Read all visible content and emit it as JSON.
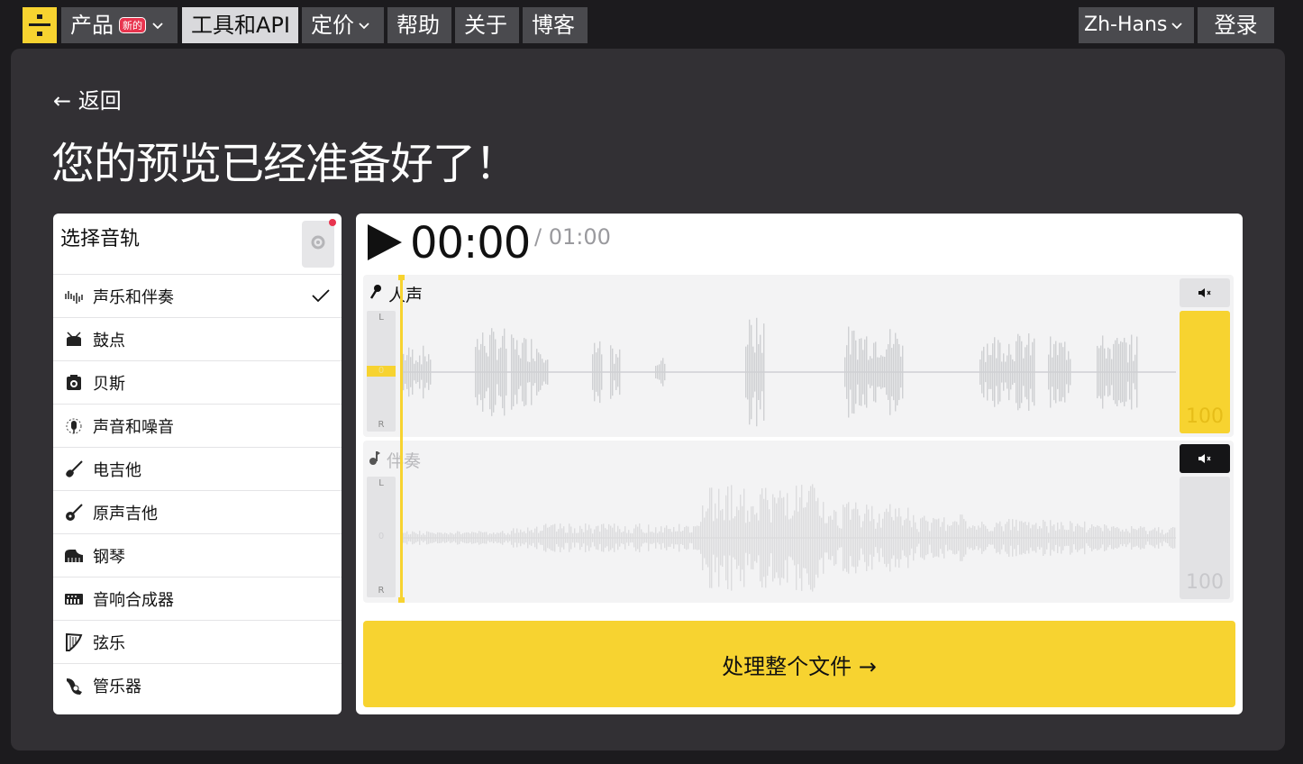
{
  "nav": {
    "products_label": "产品",
    "new_badge": "新的",
    "tools_label": "工具和API",
    "pricing_label": "定价",
    "help_label": "帮助",
    "about_label": "关于",
    "blog_label": "博客",
    "language_label": "Zh-Hans",
    "login_label": "登录"
  },
  "page": {
    "back_label": "← 返回",
    "title": "您的预览已经准备好了！"
  },
  "tracks": {
    "title": "选择音轨",
    "items": [
      {
        "label": "声乐和伴奏",
        "icon": "waveform-icon",
        "selected": true
      },
      {
        "label": "鼓点",
        "icon": "drum-icon"
      },
      {
        "label": "贝斯",
        "icon": "bass-amp-icon"
      },
      {
        "label": "声音和噪音",
        "icon": "microphone-icon"
      },
      {
        "label": "电吉他",
        "icon": "electric-guitar-icon"
      },
      {
        "label": "原声吉他",
        "icon": "acoustic-guitar-icon"
      },
      {
        "label": "钢琴",
        "icon": "piano-icon"
      },
      {
        "label": "音响合成器",
        "icon": "synthesizer-icon"
      },
      {
        "label": "弦乐",
        "icon": "harp-icon"
      },
      {
        "label": "管乐器",
        "icon": "horn-icon"
      }
    ]
  },
  "player": {
    "current_time": "00:00",
    "total_time": "/ 01:00",
    "lanes": [
      {
        "label": "人声",
        "pan_l": "L",
        "pan_mid": "0",
        "pan_r": "R",
        "volume": "100",
        "muted": false
      },
      {
        "label": "伴奏",
        "pan_l": "L",
        "pan_mid": "0",
        "pan_r": "R",
        "volume": "100",
        "muted": true
      }
    ],
    "process_label": "处理整个文件 →"
  },
  "colors": {
    "accent": "#f7d330",
    "panel": "#323034",
    "background": "#1c1b1e",
    "badge": "#e8344e"
  }
}
